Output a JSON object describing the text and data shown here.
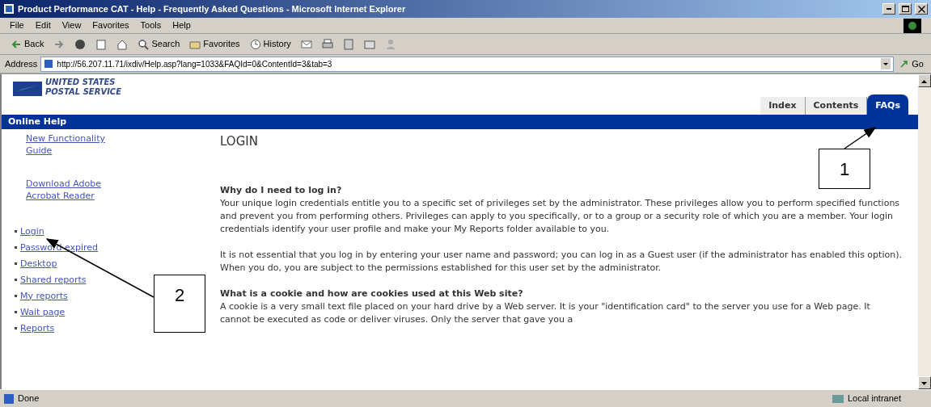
{
  "window": {
    "title": "Product Performance CAT - Help - Frequently Asked Questions - Microsoft Internet Explorer"
  },
  "menu": [
    "File",
    "Edit",
    "View",
    "Favorites",
    "Tools",
    "Help"
  ],
  "toolbar": [
    {
      "kind": "back",
      "label": "Back"
    },
    {
      "kind": "forward"
    },
    {
      "kind": "stop"
    },
    {
      "kind": "refresh"
    },
    {
      "kind": "home"
    },
    {
      "kind": "search",
      "label": "Search"
    },
    {
      "kind": "favorites",
      "label": "Favorites"
    },
    {
      "kind": "history",
      "label": "History"
    },
    {
      "kind": "mail"
    },
    {
      "kind": "print"
    },
    {
      "kind": "edit"
    },
    {
      "kind": "discuss"
    },
    {
      "kind": "messenger"
    }
  ],
  "address": {
    "label": "Address",
    "value": "http://56.207.11.71/ixdiv/Help.asp?lang=1033&FAQId=0&ContentId=3&tab=3",
    "go": "Go"
  },
  "site": {
    "logo_lines": [
      "UNITED STATES",
      "POSTAL SERVICE"
    ],
    "tabs": [
      {
        "label": "Index",
        "selected": false
      },
      {
        "label": "Contents",
        "selected": false
      },
      {
        "label": "FAQs",
        "selected": true
      }
    ],
    "banner": "Online Help"
  },
  "sidebar": {
    "links": [
      "New Functionality Guide",
      "Download Adobe Acrobat Reader"
    ],
    "items": [
      "Login",
      "Password expired",
      "Desktop",
      "Shared reports",
      "My reports",
      "Wait page",
      "Reports"
    ]
  },
  "content": {
    "title": "LOGIN",
    "sections": [
      {
        "heading": "Why do I need to log in?",
        "paragraphs": [
          "Your unique login credentials entitle you to a specific set of privileges set by the administrator. These privileges allow you to perform specified functions and prevent you from performing others. Privileges can apply to you specifically, or to a group or a security role of which you are a member. Your login credentials identify your user profile and make your My Reports folder available to you.",
          "It is not essential that you log in by entering your user name and password; you can log in as a Guest user (if the administrator has enabled this option). When you do, you are subject to the permissions established for this user set by the administrator."
        ]
      },
      {
        "heading": "What is a cookie and how are cookies used at this Web site?",
        "paragraphs": [
          "A cookie is a very small text file placed on your hard drive by a Web server. It is your \"identification card\" to the server you use for a Web page. It cannot be executed as code or deliver viruses. Only the server that gave you a"
        ]
      }
    ]
  },
  "callouts": [
    {
      "number": "1"
    },
    {
      "number": "2"
    }
  ],
  "status_bar": {
    "text": "Done",
    "zone": "Local intranet"
  }
}
